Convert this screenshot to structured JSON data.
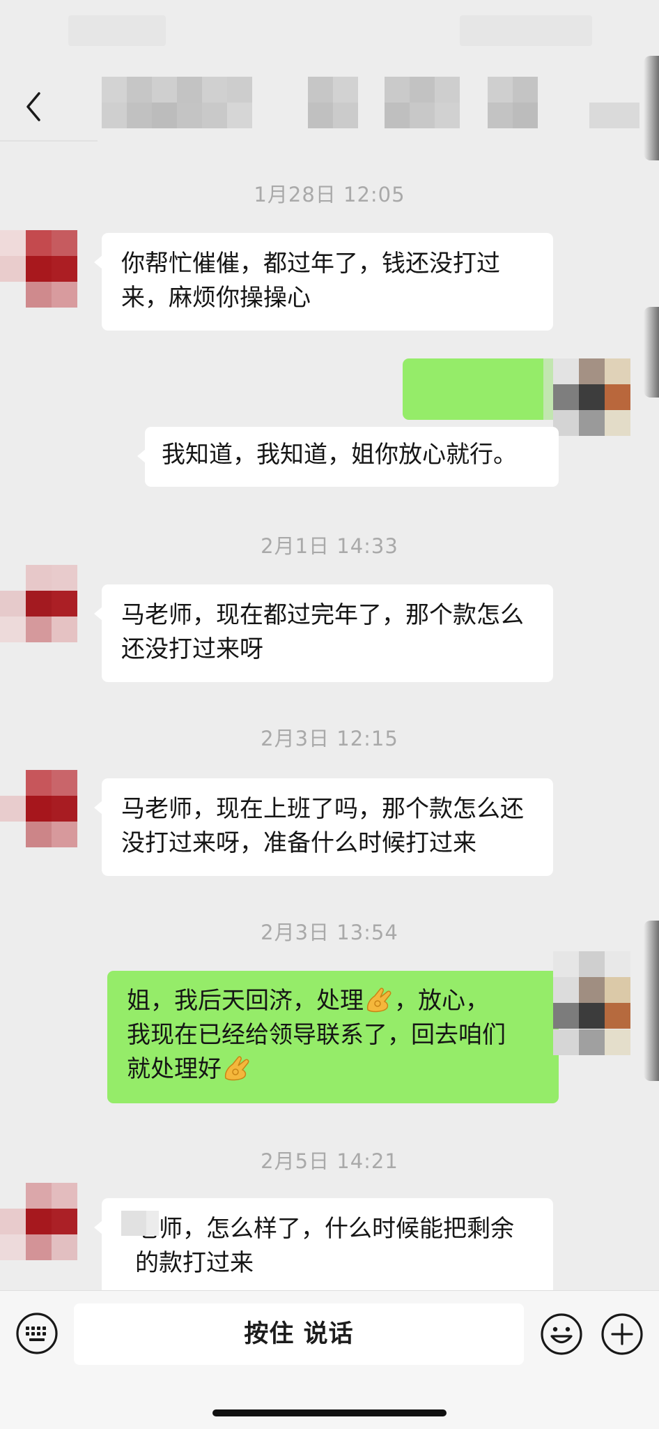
{
  "header": {
    "back_icon": "chevron-left-icon",
    "contact_name_obscured": true
  },
  "messages": [
    {
      "type": "timestamp",
      "text": "1月28日 12:05"
    },
    {
      "type": "incoming",
      "text": "你帮忙催催，都过年了，钱还没打过来，麻烦你操操心"
    },
    {
      "type": "outgoing",
      "text": ""
    },
    {
      "type": "outgoing_quote",
      "text": "我知道，我知道，姐你放心就行。"
    },
    {
      "type": "timestamp",
      "text": "2月1日 14:33"
    },
    {
      "type": "incoming",
      "text": "马老师，现在都过完年了，那个款怎么还没打过来呀"
    },
    {
      "type": "timestamp",
      "text": "2月3日 12:15"
    },
    {
      "type": "incoming",
      "text": "马老师，现在上班了吗，那个款怎么还没打过来呀，准备什么时候打过来"
    },
    {
      "type": "timestamp",
      "text": "2月3日 13:54"
    },
    {
      "type": "outgoing",
      "lines": [
        "姐，我后天回济，处理",
        "，放心，",
        "我现在已经给领导联系了，回去咱们",
        "就处理好"
      ]
    },
    {
      "type": "timestamp",
      "text": "2月5日 14:21"
    },
    {
      "type": "incoming",
      "text": "老师，怎么样了，什么时候能把剩余的款打过来"
    }
  ],
  "input_bar": {
    "hold_to_talk_label": "按住 说话",
    "keyboard_icon": "keyboard-icon",
    "emoji_icon": "smiley-icon",
    "plus_icon": "plus-circle-icon"
  },
  "colors": {
    "background": "#ededed",
    "incoming_bubble": "#ffffff",
    "outgoing_bubble": "#95ec69",
    "timestamp_text": "#a9a9a9"
  }
}
